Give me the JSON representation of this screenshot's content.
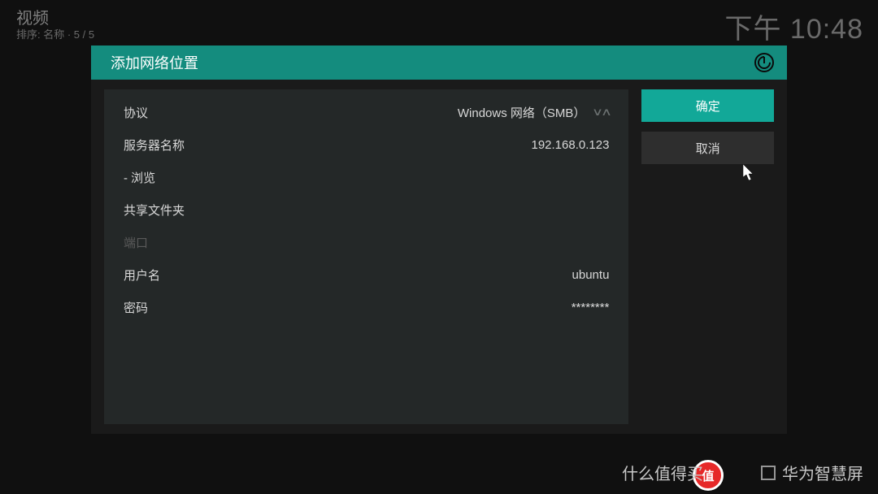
{
  "header": {
    "title": "视频",
    "subtitle": "排序: 名称  ·  5 / 5"
  },
  "clock": "下午 10:48",
  "dialog": {
    "title": "添加网络位置",
    "fields": {
      "protocol": {
        "label": "协议",
        "value": "Windows 网络（SMB）"
      },
      "server": {
        "label": "服务器名称",
        "value": "192.168.0.123"
      },
      "browse": {
        "label": "- 浏览"
      },
      "share": {
        "label": "共享文件夹"
      },
      "port": {
        "label": "端口"
      },
      "username": {
        "label": "用户名",
        "value": "ubuntu"
      },
      "password": {
        "label": "密码",
        "value": "********"
      }
    },
    "buttons": {
      "confirm": "确定",
      "cancel": "取消"
    }
  },
  "watermark": {
    "badge": "值",
    "text": "什么值得买",
    "brand": "华为智慧屏"
  }
}
